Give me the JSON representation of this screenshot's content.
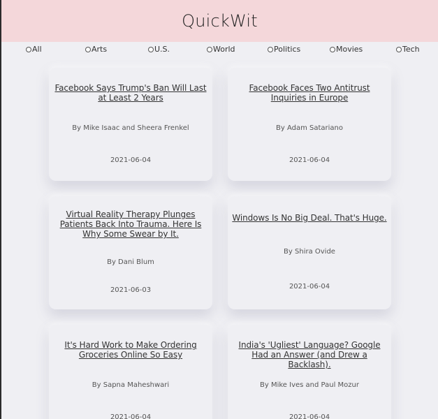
{
  "app": {
    "title": "QuickWit"
  },
  "filters": [
    {
      "label": "All"
    },
    {
      "label": "Arts"
    },
    {
      "label": "U.S."
    },
    {
      "label": "World"
    },
    {
      "label": "Politics"
    },
    {
      "label": "Movies"
    },
    {
      "label": "Tech"
    }
  ],
  "articles": [
    {
      "title": "Facebook Says Trump's Ban Will Last at Least 2 Years",
      "author": "By Mike Isaac and Sheera Frenkel",
      "date": "2021-06-04"
    },
    {
      "title": "Facebook Faces Two Antitrust Inquiries in Europe",
      "author": "By Adam Satariano",
      "date": "2021-06-04"
    },
    {
      "title": "Virtual Reality Therapy Plunges Patients Back Into Trauma. Here Is Why Some Swear by It.",
      "author": "By Dani Blum",
      "date": "2021-06-03"
    },
    {
      "title": "Windows Is No Big Deal. That's Huge.",
      "author": "By Shira Ovide",
      "date": "2021-06-04"
    },
    {
      "title": "It's Hard Work to Make Ordering Groceries Online So Easy",
      "author": "By Sapna Maheshwari",
      "date": "2021-06-04"
    },
    {
      "title": "India's 'Ugliest' Language? Google Had an Answer (and Drew a Backlash).",
      "author": "By Mike Ives and Paul Mozur",
      "date": "2021-06-04"
    }
  ]
}
